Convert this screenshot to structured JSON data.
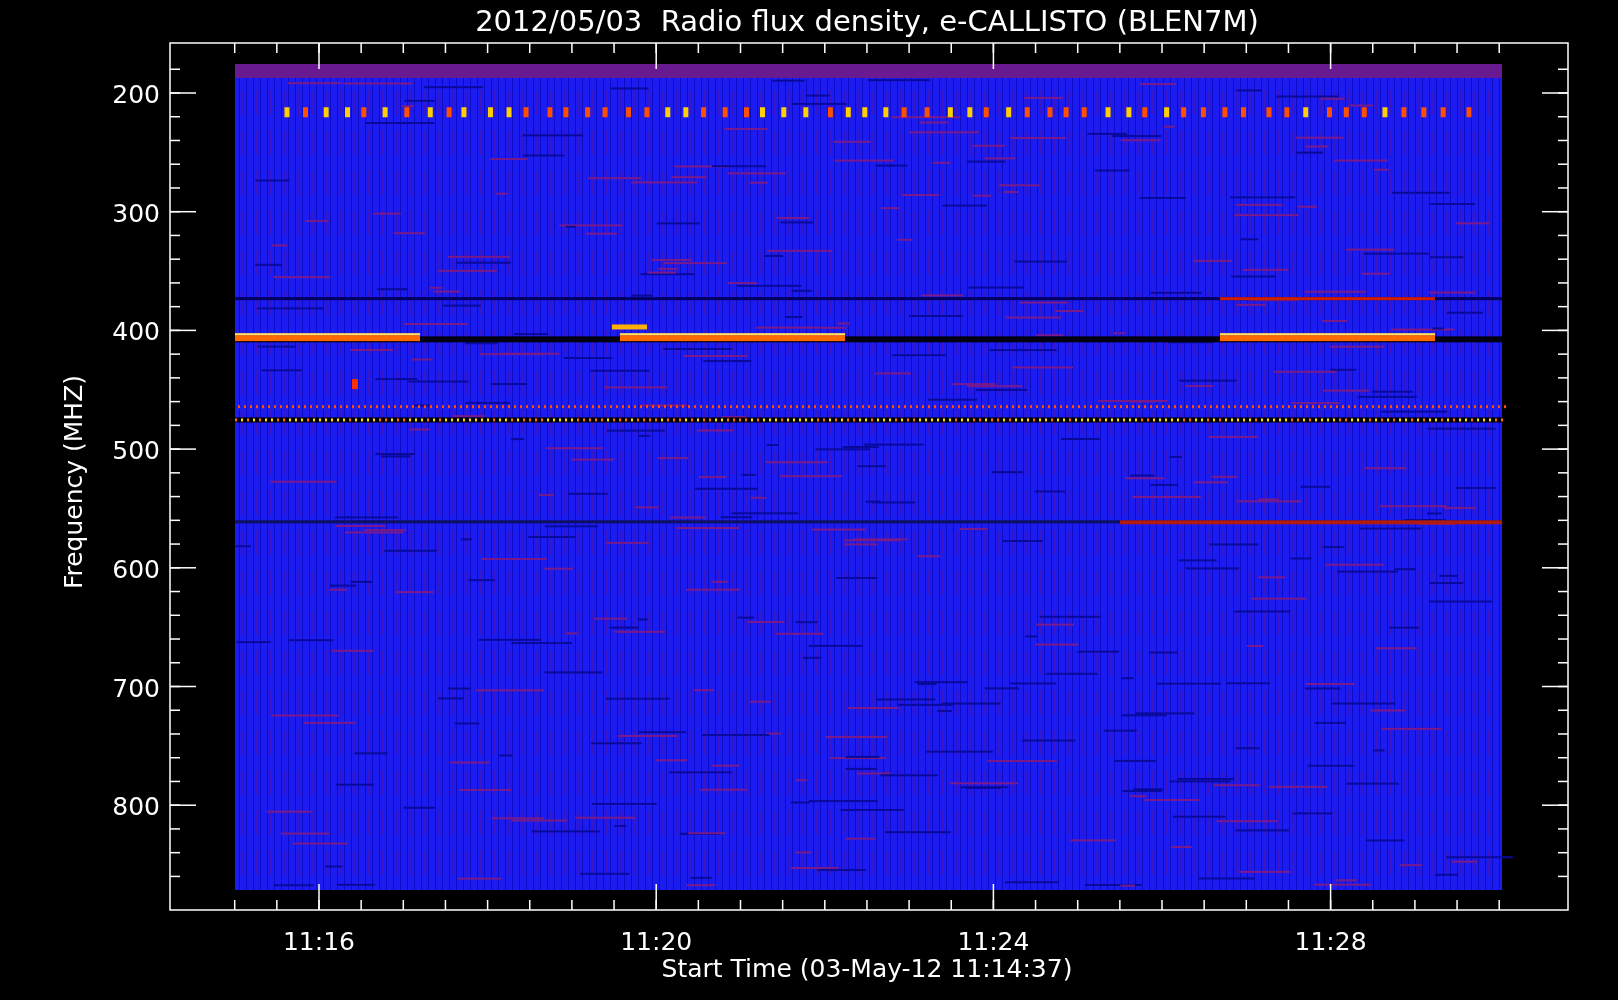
{
  "title": "2012/05/03  Radio flux density, e-CALLISTO (BLEN7M)",
  "y_axis": {
    "label": "Frequency (MHZ)",
    "ticks": [
      "200",
      "300",
      "400",
      "500",
      "600",
      "700",
      "800"
    ]
  },
  "x_axis": {
    "label": "Start Time (03-May-12 11:14:37)",
    "ticks": [
      "11:16",
      "11:20",
      "11:24",
      "11:28"
    ]
  }
}
